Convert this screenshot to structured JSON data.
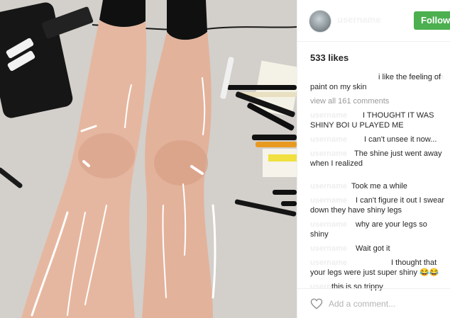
{
  "post": {
    "username": "username",
    "follow_label": "Followi",
    "likes": "533 likes",
    "view_all": "view all 161 comments",
    "add_comment_placeholder": "Add a comment..."
  },
  "comments": [
    {
      "user": "username",
      "text": "i like the feeling of paint on my skin"
    },
    {
      "user": "username",
      "text": "I THOUGHT IT WAS SHINY BOI U PLAYED ME"
    },
    {
      "user": "username",
      "text": "I can't unsee it now..."
    },
    {
      "user": "username",
      "text": "The shine just went away when I realized"
    },
    {
      "user": "username",
      "text": "Took me a while"
    },
    {
      "user": "username",
      "text": "I can't figure it out I swear down they have shiny legs"
    },
    {
      "user": "username",
      "text": "why are your legs so shiny"
    },
    {
      "user": "username",
      "text": "Wait got it"
    },
    {
      "user": "username",
      "text": "I thought that your legs were just super shiny 😂😂"
    },
    {
      "user": "username",
      "text": "this is so trippy"
    }
  ],
  "colors": {
    "follow_bg": "#4caf50",
    "text": "#262626",
    "muted": "#999999"
  },
  "icons": {
    "like": "heart-outline-icon"
  }
}
